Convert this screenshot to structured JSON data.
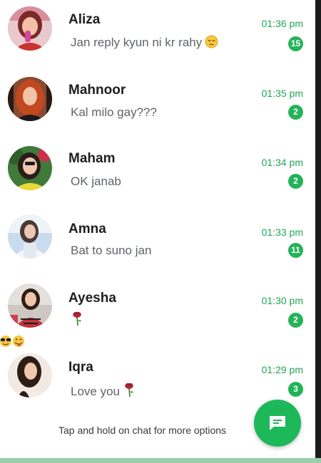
{
  "chats": [
    {
      "name": "Aliza",
      "message": "Jan reply kyun ni kr rahy",
      "time": "01:36 pm",
      "unread": "15",
      "message_emoji": "pensive-face-emoji",
      "avatar": "profile-photo"
    },
    {
      "name": "Mahnoor",
      "message": "Kal milo gay???",
      "time": "01:35 pm",
      "unread": "2",
      "avatar": "profile-photo"
    },
    {
      "name": "Maham",
      "message": "OK janab",
      "time": "01:34 pm",
      "unread": "2",
      "avatar": "profile-photo"
    },
    {
      "name": "Amna",
      "message": "Bat to suno jan",
      "time": "01:33 pm",
      "unread": "11",
      "avatar": "profile-photo"
    },
    {
      "name": "Ayesha",
      "message": "",
      "time": "01:30 pm",
      "unread": "2",
      "message_emoji": "wilted-rose-emoji",
      "avatar": "profile-photo"
    },
    {
      "name": "Iqra",
      "message": "Love you",
      "time": "01:29 pm",
      "unread": "3",
      "message_emoji": "wilted-rose-emoji",
      "avatar": "profile-photo"
    }
  ],
  "footer": {
    "hint": "Tap and hold on chat for more options"
  },
  "fab": {
    "icon": "new-chat-icon"
  },
  "overlay_emojis": [
    "sunglasses-face-emoji",
    "winking-tongue-face-emoji"
  ],
  "colors": {
    "accent": "#25b35a",
    "time_text": "#1fa855",
    "fab": "#1db85a",
    "bottom_strip": "#9fcda9"
  }
}
